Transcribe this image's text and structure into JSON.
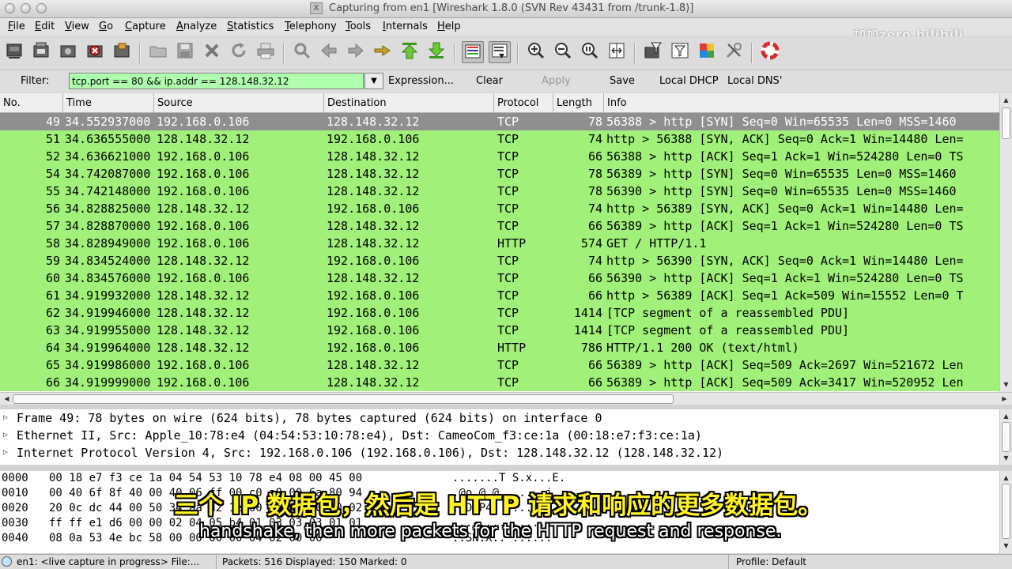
{
  "window": {
    "title": "Capturing from en1   [Wireshark 1.8.0  (SVN Rev 43431 from /trunk-1.8)]",
    "close_glyph": "X"
  },
  "menu": [
    "File",
    "Edit",
    "View",
    "Go",
    "Capture",
    "Analyze",
    "Statistics",
    "Telephony",
    "Tools",
    "Internals",
    "Help"
  ],
  "filter": {
    "label": "Filter:",
    "value": "tcp.port == 80 && ip.addr == 128.148.32.12",
    "bg_color": "#afffaf",
    "buttons": [
      "Expression...",
      "Clear",
      "Apply",
      "Save",
      "Local DHCP",
      "Local DNS'"
    ]
  },
  "packet_list": {
    "columns": [
      "No.",
      "Time",
      "Source",
      "Destination",
      "Protocol",
      "Length",
      "Info"
    ],
    "row_color": "#a0f07a",
    "selected_color": "#8f8f8f",
    "rows": [
      {
        "no": "49",
        "time": "34.552937000",
        "src": "192.168.0.106",
        "dst": "128.148.32.12",
        "proto": "TCP",
        "len": "78",
        "info": "56388 > http [SYN] Seq=0 Win=65535 Len=0 MSS=1460",
        "selected": true
      },
      {
        "no": "51",
        "time": "34.636555000",
        "src": "128.148.32.12",
        "dst": "192.168.0.106",
        "proto": "TCP",
        "len": "74",
        "info": "http > 56388 [SYN, ACK] Seq=0 Ack=1 Win=14480 Len="
      },
      {
        "no": "52",
        "time": "34.636621000",
        "src": "192.168.0.106",
        "dst": "128.148.32.12",
        "proto": "TCP",
        "len": "66",
        "info": "56388 > http [ACK] Seq=1 Ack=1 Win=524280 Len=0 TS"
      },
      {
        "no": "54",
        "time": "34.742087000",
        "src": "192.168.0.106",
        "dst": "128.148.32.12",
        "proto": "TCP",
        "len": "78",
        "info": "56389 > http [SYN] Seq=0 Win=65535 Len=0 MSS=1460"
      },
      {
        "no": "55",
        "time": "34.742148000",
        "src": "192.168.0.106",
        "dst": "128.148.32.12",
        "proto": "TCP",
        "len": "78",
        "info": "56390 > http [SYN] Seq=0 Win=65535 Len=0 MSS=1460"
      },
      {
        "no": "56",
        "time": "34.828825000",
        "src": "128.148.32.12",
        "dst": "192.168.0.106",
        "proto": "TCP",
        "len": "74",
        "info": "http > 56389 [SYN, ACK] Seq=0 Ack=1 Win=14480 Len="
      },
      {
        "no": "57",
        "time": "34.828870000",
        "src": "192.168.0.106",
        "dst": "128.148.32.12",
        "proto": "TCP",
        "len": "66",
        "info": "56389 > http [ACK] Seq=1 Ack=1 Win=524280 Len=0 TS"
      },
      {
        "no": "58",
        "time": "34.828949000",
        "src": "192.168.0.106",
        "dst": "128.148.32.12",
        "proto": "HTTP",
        "len": "574",
        "info": "GET / HTTP/1.1"
      },
      {
        "no": "59",
        "time": "34.834524000",
        "src": "128.148.32.12",
        "dst": "192.168.0.106",
        "proto": "TCP",
        "len": "74",
        "info": "http > 56390 [SYN, ACK] Seq=0 Ack=1 Win=14480 Len="
      },
      {
        "no": "60",
        "time": "34.834576000",
        "src": "192.168.0.106",
        "dst": "128.148.32.12",
        "proto": "TCP",
        "len": "66",
        "info": "56390 > http [ACK] Seq=1 Ack=1 Win=524280 Len=0 TS"
      },
      {
        "no": "61",
        "time": "34.919932000",
        "src": "128.148.32.12",
        "dst": "192.168.0.106",
        "proto": "TCP",
        "len": "66",
        "info": "http > 56389 [ACK] Seq=1 Ack=509 Win=15552 Len=0 T"
      },
      {
        "no": "62",
        "time": "34.919946000",
        "src": "128.148.32.12",
        "dst": "192.168.0.106",
        "proto": "TCP",
        "len": "1414",
        "info": "[TCP segment of a reassembled PDU]"
      },
      {
        "no": "63",
        "time": "34.919955000",
        "src": "128.148.32.12",
        "dst": "192.168.0.106",
        "proto": "TCP",
        "len": "1414",
        "info": "[TCP segment of a reassembled PDU]"
      },
      {
        "no": "64",
        "time": "34.919964000",
        "src": "128.148.32.12",
        "dst": "192.168.0.106",
        "proto": "HTTP",
        "len": "786",
        "info": "HTTP/1.1 200 OK  (text/html)"
      },
      {
        "no": "65",
        "time": "34.919986000",
        "src": "192.168.0.106",
        "dst": "128.148.32.12",
        "proto": "TCP",
        "len": "66",
        "info": "56389 > http [ACK] Seq=509 Ack=2697 Win=521672 Len"
      },
      {
        "no": "66",
        "time": "34.919999000",
        "src": "192.168.0.106",
        "dst": "128.148.32.12",
        "proto": "TCP",
        "len": "66",
        "info": "56389 > http [ACK] Seq=509 Ack=3417 Win=520952 Len"
      }
    ]
  },
  "details": [
    "Frame 49: 78 bytes on wire (624 bits), 78 bytes captured (624 bits) on interface 0",
    "Ethernet II, Src: Apple_10:78:e4 (04:54:53:10:78:e4), Dst: CameoCom_f3:ce:1a (00:18:e7:f3:ce:1a)",
    "Internet Protocol Version 4, Src: 192.168.0.106 (192.168.0.106), Dst: 128.148.32.12 (128.148.32.12)"
  ],
  "bytes": [
    {
      "off": "0000",
      "hex": "00 18 e7 f3 ce 1a 04 54  53 10 78 e4 08 00 45 00",
      "ascii": ".......T S.x...E."
    },
    {
      "off": "0010",
      "hex": "00 40 6f 8f 40 00 40 06  ff 00 c0 a8 00 6a 80 94",
      "ascii": ".@o.@.@. .....j.."
    },
    {
      "off": "0020",
      "hex": "20 0c dc 44 00 50 34 aa  d2 1e 00 00 00 00 b0 02",
      "ascii": " ..D.P4. ........"
    },
    {
      "off": "0030",
      "hex": "ff ff e1 d6 00 00 02 04  05 b4 01 03 03 03 01 01",
      "ascii": "........ ........"
    },
    {
      "off": "0040",
      "hex": "08 0a 53 4e bc 58 00 00  00 00 04 02 00 00",
      "ascii": "..SN.X.. ......"
    }
  ],
  "status": {
    "capture": "en1: <live capture in progress> File:...",
    "packets": "Packets: 516 Displayed: 150 Marked: 0",
    "profile": "Profile: Default"
  },
  "overlay": {
    "watermark": "加加zero bilibili",
    "subtitle_cn": "三个 IP 数据包，然后是 HTTP 请求和响应的更多数据包。",
    "subtitle_en": "handshake, then more packets for the HTTP request and response."
  },
  "toolbar_icons": [
    "interface-list-icon",
    "capture-options-icon",
    "start-capture-icon",
    "stop-capture-icon",
    "restart-capture-icon",
    "open-file-icon",
    "save-file-icon",
    "close-file-icon",
    "reload-icon",
    "print-icon",
    "find-icon",
    "back-icon",
    "forward-icon",
    "goto-packet-icon",
    "first-packet-icon",
    "last-packet-icon",
    "colorize-icon",
    "autoscroll-icon",
    "zoom-in-icon",
    "zoom-out-icon",
    "normal-size-icon",
    "resize-columns-icon",
    "capture-filters-icon",
    "display-filters-icon",
    "coloring-rules-icon",
    "preferences-icon",
    "help-icon"
  ]
}
